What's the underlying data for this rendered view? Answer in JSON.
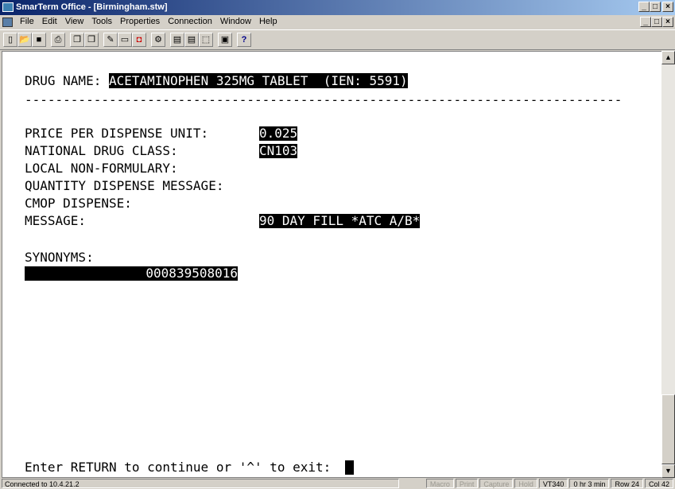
{
  "window": {
    "title": "SmarTerm Office - [Birmingham.stw]",
    "controls": {
      "minimize": "_",
      "maximize": "□",
      "close": "×"
    }
  },
  "menu": {
    "items": [
      "File",
      "Edit",
      "View",
      "Tools",
      "Properties",
      "Connection",
      "Window",
      "Help"
    ]
  },
  "toolbar": {
    "buttons": [
      {
        "name": "new-icon",
        "glyph": "▯"
      },
      {
        "name": "open-icon",
        "glyph": "📂"
      },
      {
        "name": "save-icon",
        "glyph": "■"
      },
      {
        "name": "print-icon",
        "glyph": "⎙"
      },
      {
        "name": "copy-icon",
        "glyph": "❐"
      },
      {
        "name": "paste-icon",
        "glyph": "❐"
      },
      {
        "name": "edit-icon",
        "glyph": "✎"
      },
      {
        "name": "macro-icon",
        "glyph": "▭"
      },
      {
        "name": "record-icon",
        "glyph": "◘"
      },
      {
        "name": "settings-icon",
        "glyph": "⚙"
      },
      {
        "name": "page-icon",
        "glyph": "▤"
      },
      {
        "name": "page2-icon",
        "glyph": "▤"
      },
      {
        "name": "select-icon",
        "glyph": "⬚"
      },
      {
        "name": "screen-icon",
        "glyph": "▣"
      },
      {
        "name": "help-icon",
        "glyph": "?"
      }
    ]
  },
  "terminal": {
    "drug_label": "DRUG NAME: ",
    "drug_value": "ACETAMINOPHEN 325MG TABLET  (IEN: 5591)",
    "divider": "------------------------------------------------------------------------------",
    "price_label": "PRICE PER DISPENSE UNIT:",
    "price_value": "0.025",
    "class_label": "NATIONAL DRUG CLASS:",
    "class_value": "CN103",
    "nonformulary_label": "LOCAL NON-FORMULARY:",
    "qty_label": "QUANTITY DISPENSE MESSAGE:",
    "cmop_label": "CMOP DISPENSE:",
    "message_label": "MESSAGE:",
    "message_value": "90 DAY FILL *ATC A/B*",
    "synonyms_label": "SYNONYMS:",
    "synonym_value": "000839508016",
    "prompt": "Enter RETURN to continue or '^' to exit: "
  },
  "status": {
    "connection": "Connected to 10.4.21.2",
    "macro": "Macro",
    "print": "Print",
    "capture": "Capture",
    "hold": "Hold",
    "emulation": "VT340",
    "timer": "0 hr 3 min",
    "row": "Row 24",
    "col": "Col 42"
  }
}
